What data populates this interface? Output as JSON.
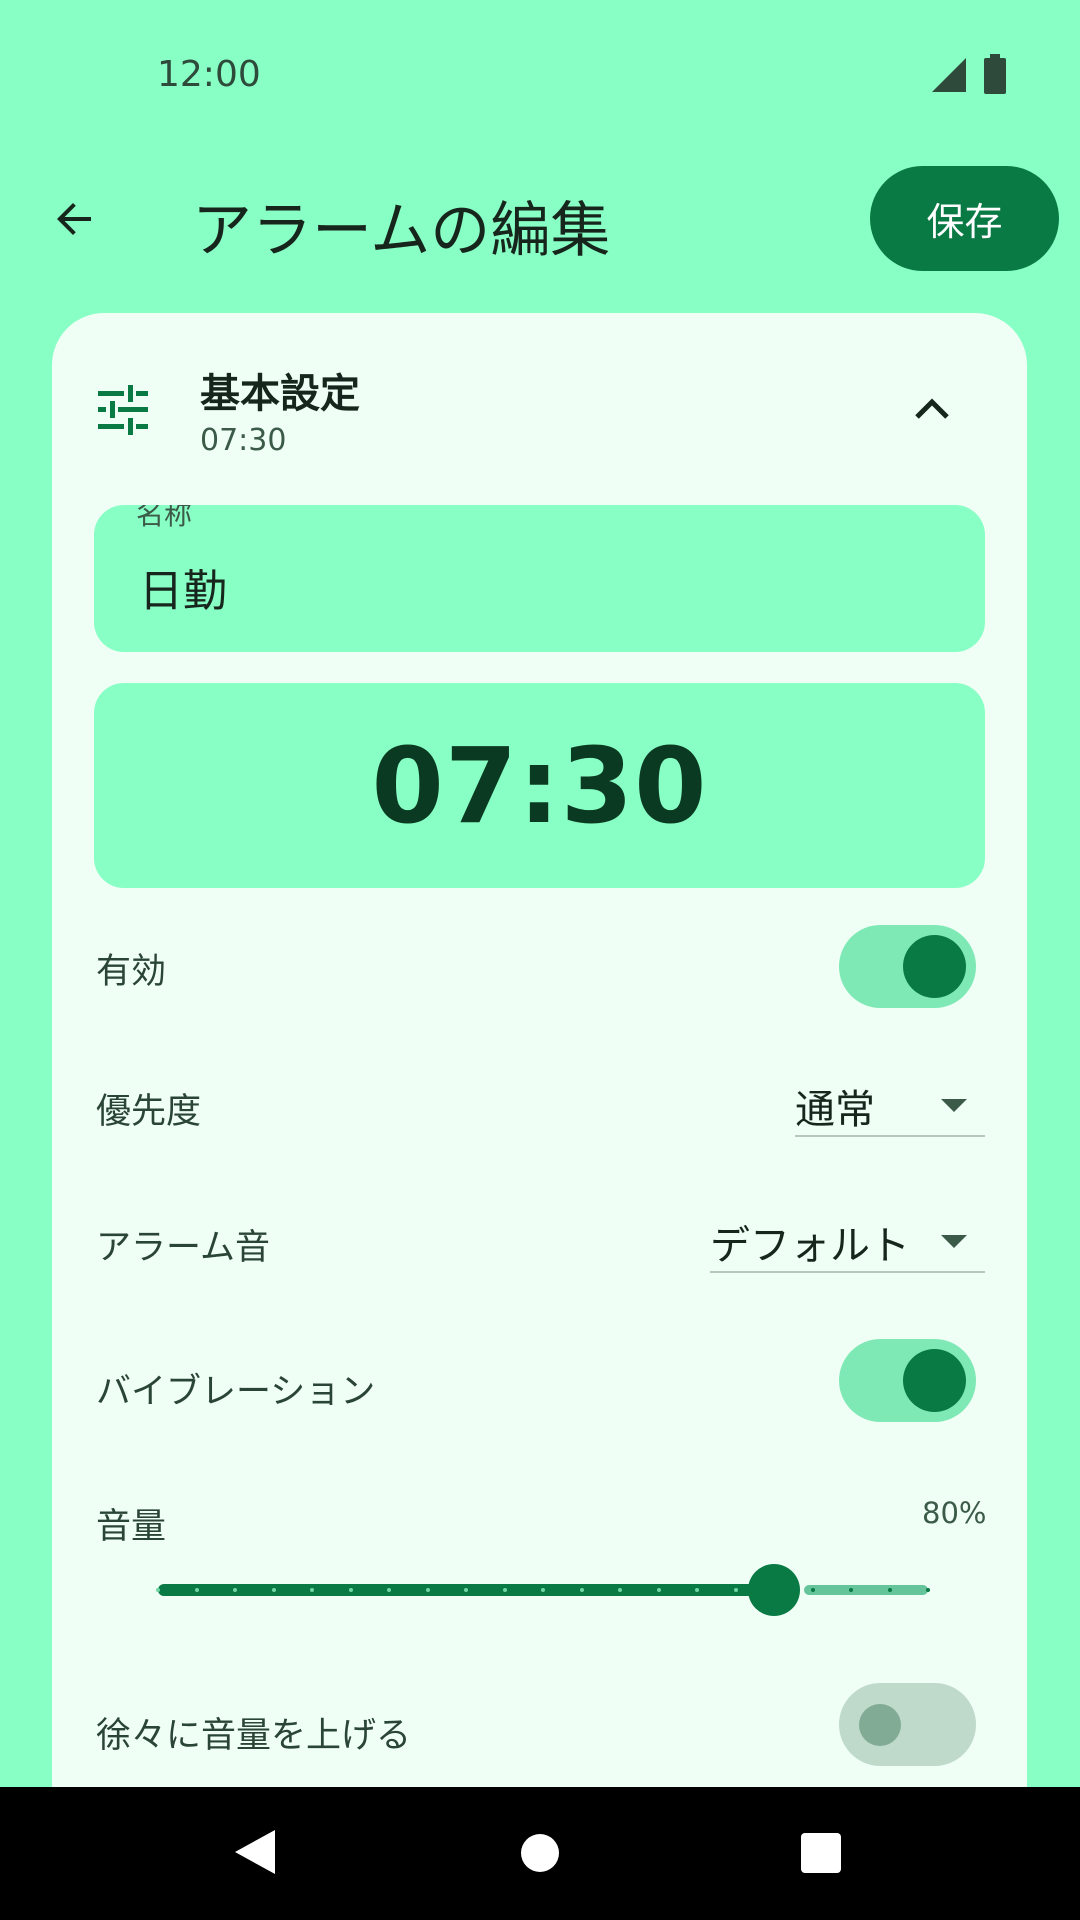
{
  "status_bar": {
    "time": "12:00",
    "icons": [
      "signal-icon",
      "battery-icon"
    ]
  },
  "header": {
    "title": "アラームの編集",
    "save_label": "保存",
    "back_icon": "arrow-back-icon"
  },
  "section": {
    "title": "基本設定",
    "subtitle": "07:30",
    "icon": "tune-icon",
    "collapse_icon": "chevron-up-icon",
    "expanded": true
  },
  "name_field": {
    "label": "名称",
    "value": "日勤"
  },
  "time_display": "07:30",
  "enabled": {
    "label": "有効",
    "on": true
  },
  "priority": {
    "label": "優先度",
    "value": "通常"
  },
  "alarm_sound": {
    "label": "アラーム音",
    "value": "デフォルト"
  },
  "vibration": {
    "label": "バイブレーション",
    "on": true
  },
  "volume": {
    "label": "音量",
    "value_text": "80%",
    "value": 0.8,
    "steps": 20
  },
  "gradual_volume": {
    "label": "徐々に音量を上げる",
    "on": false
  },
  "navbar": {
    "icons": [
      "nav-back-icon",
      "nav-home-icon",
      "nav-recents-icon"
    ]
  },
  "colors": {
    "background": "#88ffc4",
    "card": "#effff6",
    "accent": "#0a7a45",
    "field": "#88ffc4"
  }
}
